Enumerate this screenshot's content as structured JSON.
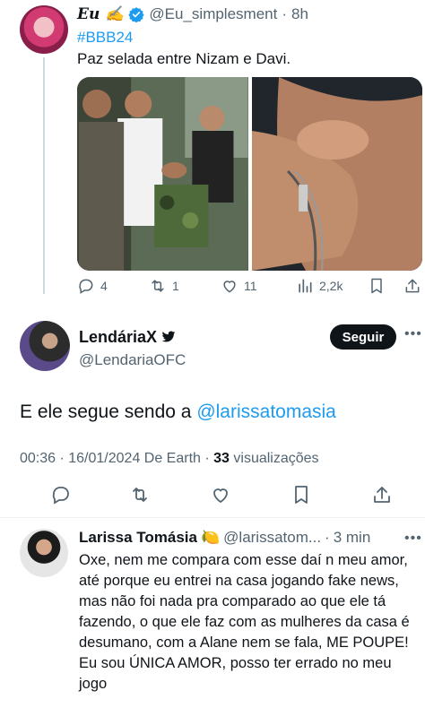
{
  "tweet1": {
    "display_name": "Eu ✍️",
    "handle": "@Eu_simplesment",
    "time": "8h",
    "hashtag": "#BBB24",
    "text": "Paz selada entre Nizam e Davi.",
    "stats": {
      "replies": "4",
      "retweets": "1",
      "likes": "11",
      "views": "2,2k"
    }
  },
  "tweet2": {
    "display_name": "LendáriaX",
    "handle": "@LendariaOFC",
    "follow_label": "Seguir",
    "body_prefix": "E ele segue sendo a ",
    "mention": "@larissatomasia",
    "meta_prefix": "00:36 · 16/01/2024 De Earth · ",
    "views_count": "33",
    "views_label": " visualizações"
  },
  "reply": {
    "display_name": "Larissa Tomásia",
    "emoji": "🍋",
    "handle": "@larissatom...",
    "time": "3 min",
    "text": "Oxe, nem me compara com esse daí n meu amor, até porque eu entrei na casa jogando fake news, mas não foi nada pra comparado ao que ele tá fazendo, o que ele faz com as mulheres da casa é desumano, com a Alane nem se fala, ME POUPE! Eu sou ÚNICA AMOR, posso ter errado no meu jogo"
  },
  "colors": {
    "accent": "#1d9bf0",
    "text": "#0f1419",
    "muted": "#536471"
  },
  "icons": [
    "reply-icon",
    "retweet-icon",
    "like-icon",
    "views-icon",
    "bookmark-icon",
    "share-icon",
    "verified-badge-icon",
    "more-icon"
  ]
}
